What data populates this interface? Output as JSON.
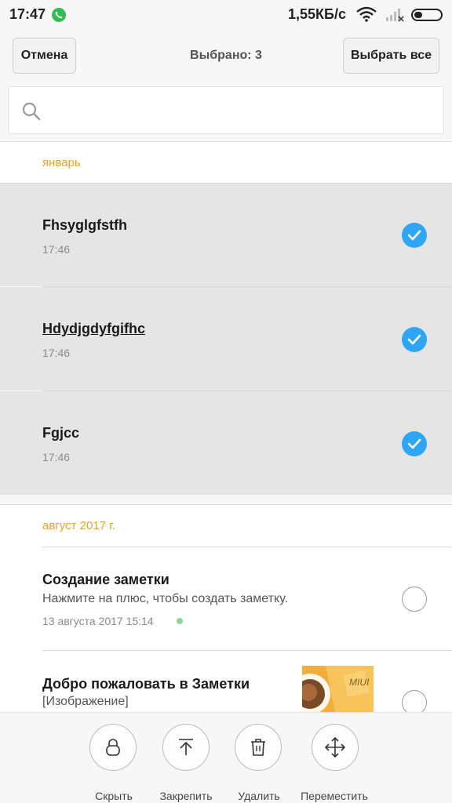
{
  "status_bar": {
    "time": "17:47",
    "speed": "1,55КБ/с"
  },
  "header": {
    "cancel_label": "Отмена",
    "title": "Выбрано: 3",
    "select_all_label": "Выбрать все"
  },
  "search": {
    "placeholder": ""
  },
  "sections": [
    {
      "header": "январь",
      "notes": [
        {
          "title": "Fhsyglgfstfh",
          "time": "17:46",
          "selected": true
        },
        {
          "title": "Hdydjgdyfgifhc",
          "time": "17:46",
          "selected": true
        },
        {
          "title": "Fgjcc",
          "time": "17:46",
          "selected": true
        }
      ]
    },
    {
      "header": "август 2017 г.",
      "notes": [
        {
          "title": "Создание заметки",
          "subtitle": "Нажмите на плюс, чтобы создать заметку.",
          "time": "13 августа 2017 15:14",
          "selected": false
        },
        {
          "title": "Добро пожаловать в Заметки",
          "subtitle": "[Изображение]",
          "thumbnail_text": "MIUI",
          "selected": false
        }
      ]
    }
  ],
  "toolbar": [
    {
      "label": "Скрыть",
      "icon": "lock-icon"
    },
    {
      "label": "Закрепить",
      "icon": "pin-top-icon"
    },
    {
      "label": "Удалить",
      "icon": "trash-icon"
    },
    {
      "label": "Переместить",
      "icon": "move-icon"
    }
  ],
  "colors": {
    "accent": "#2ea6f5",
    "section_header": "#f0a21b",
    "selected_row": "#e5e5e5",
    "status_dot": "#8fd39b"
  }
}
